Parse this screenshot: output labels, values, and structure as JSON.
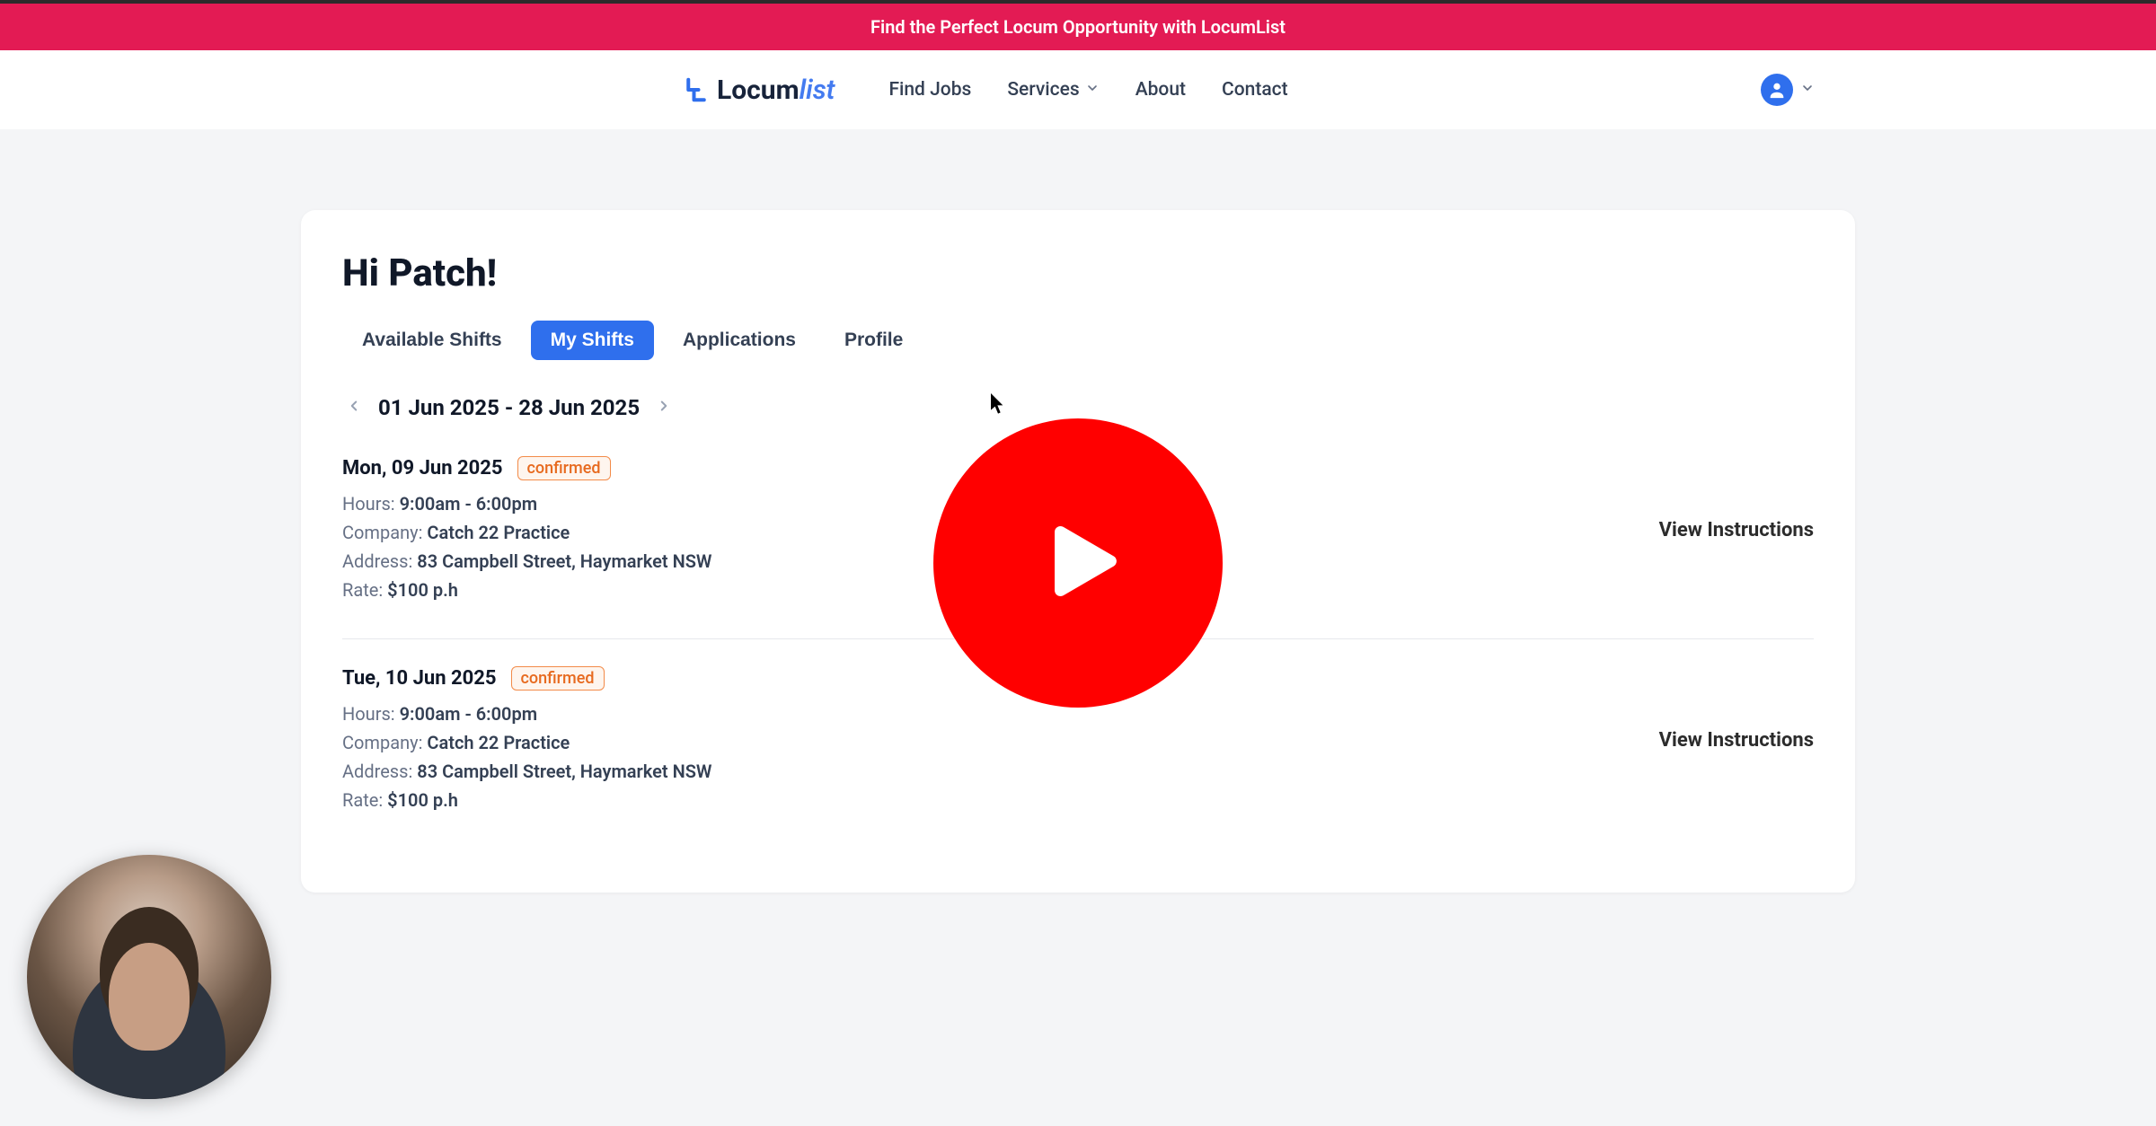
{
  "banner": {
    "text": "Find the Perfect Locum Opportunity with LocumList"
  },
  "logo": {
    "word1": "Locum",
    "word2": "list"
  },
  "nav": {
    "find_jobs": "Find Jobs",
    "services": "Services",
    "about": "About",
    "contact": "Contact"
  },
  "greeting": "Hi Patch!",
  "tabs": {
    "available": "Available Shifts",
    "my_shifts": "My Shifts",
    "applications": "Applications",
    "profile": "Profile"
  },
  "date_range": "01 Jun 2025 - 28 Jun 2025",
  "labels": {
    "hours": "Hours:",
    "company": "Company:",
    "address": "Address:",
    "rate": "Rate:",
    "view_instructions": "View Instructions"
  },
  "shifts": [
    {
      "date": "Mon, 09 Jun 2025",
      "status": "confirmed",
      "hours": "9:00am - 6:00pm",
      "company": "Catch 22 Practice",
      "address": "83 Campbell Street, Haymarket NSW",
      "rate": "$100 p.h"
    },
    {
      "date": "Tue, 10 Jun 2025",
      "status": "confirmed",
      "hours": "9:00am - 6:00pm",
      "company": "Catch 22 Practice",
      "address": "83 Campbell Street, Haymarket NSW",
      "rate": "$100 p.h"
    }
  ]
}
